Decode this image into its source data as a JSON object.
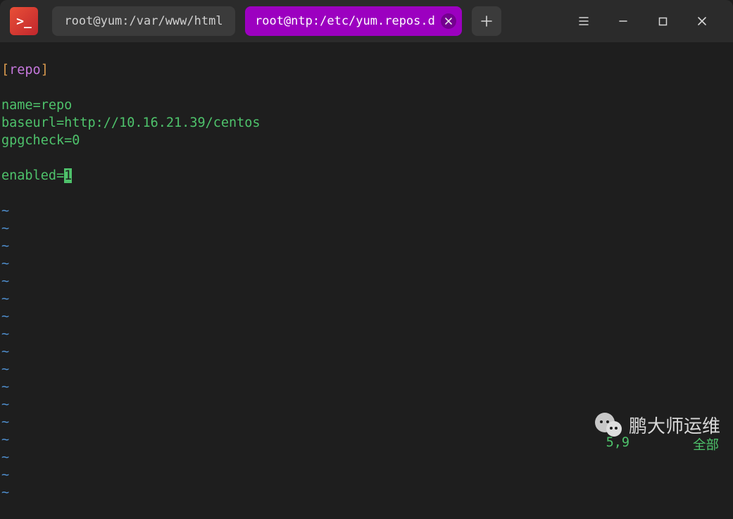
{
  "app_icon_glyph": ">_",
  "tabs": [
    {
      "label": "root@yum:/var/www/html",
      "active": false
    },
    {
      "label": "root@ntp:/etc/yum.repos.d",
      "active": true
    }
  ],
  "editor": {
    "section_open": "[",
    "section_name": "repo",
    "section_close": "]",
    "lines": [
      {
        "key": "name",
        "eq": "=",
        "val": "repo"
      },
      {
        "key": "baseurl",
        "eq": "=",
        "val": "http://10.16.21.39/centos"
      },
      {
        "key": "gpgcheck",
        "eq": "=",
        "val": "0"
      }
    ],
    "cursor_line": {
      "key": "enabled",
      "eq": "=",
      "val": "1"
    },
    "tilde": "~",
    "tilde_count": 17
  },
  "status": {
    "pos": "5,9",
    "mode": "全部"
  },
  "watermark": "鹏大师运维"
}
